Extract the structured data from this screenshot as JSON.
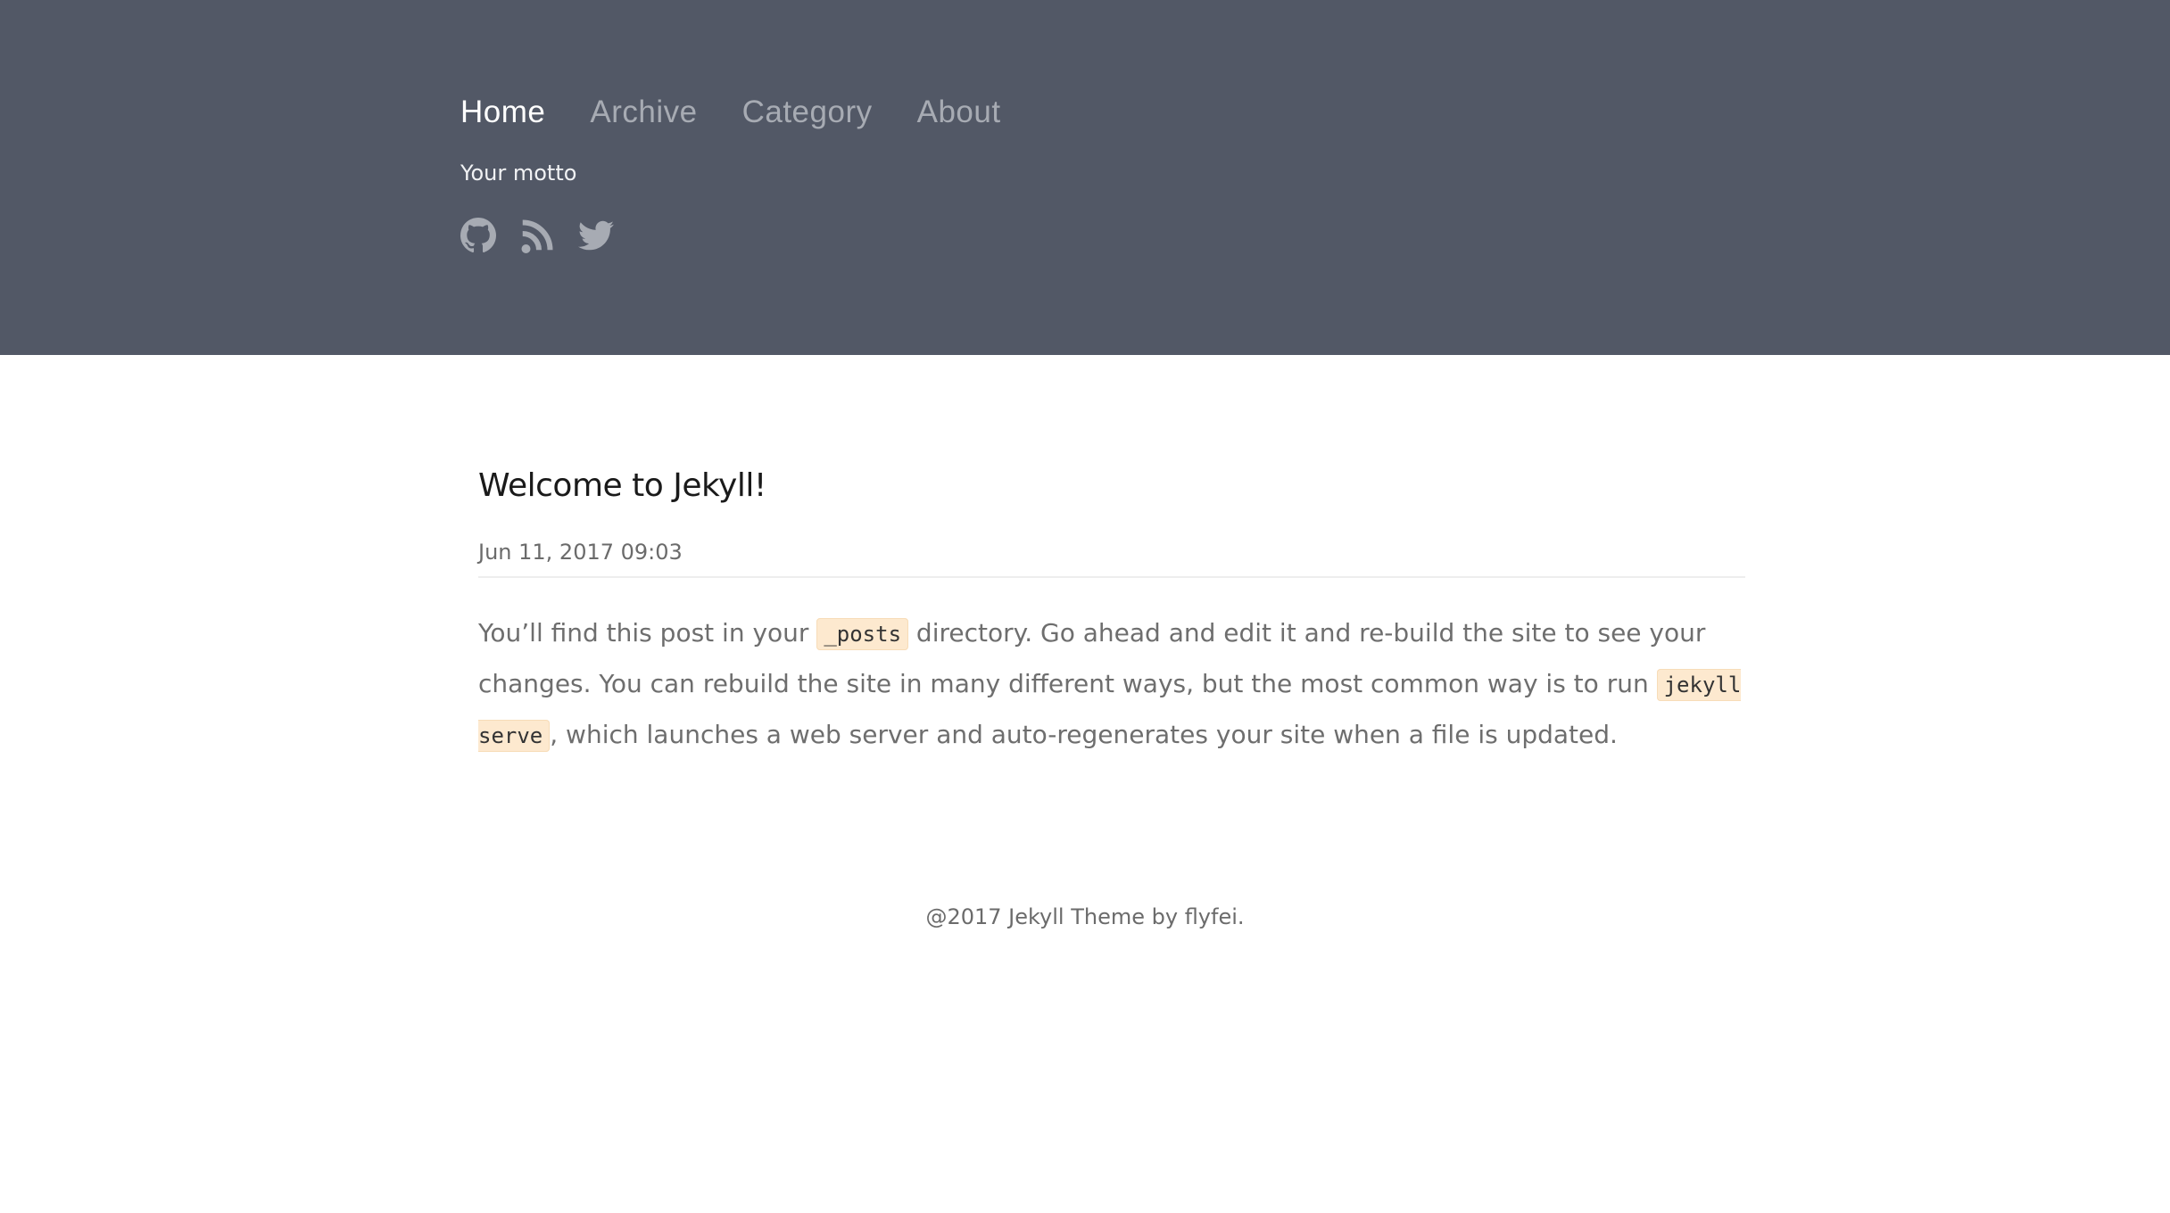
{
  "header": {
    "nav": [
      {
        "label": "Home",
        "active": true
      },
      {
        "label": "Archive",
        "active": false
      },
      {
        "label": "Category",
        "active": false
      },
      {
        "label": "About",
        "active": false
      }
    ],
    "motto": "Your motto",
    "social_icons": [
      "github-icon",
      "rss-icon",
      "twitter-icon"
    ],
    "background_color": "#525866"
  },
  "post": {
    "title": "Welcome to Jekyll!",
    "date": "Jun 11, 2017 09:03",
    "body": {
      "part1": "You’ll find this post in your ",
      "code1": "_posts",
      "part2": " directory. Go ahead and edit it and re-build the site to see your changes. You can rebuild the site in many different ways, but the most common way is to run ",
      "code2": "jekyll serve",
      "part3": ", which launches a web server and auto-regenerates your site when a file is updated."
    }
  },
  "footer": {
    "text": "@2017 Jekyll Theme by flyfei."
  }
}
